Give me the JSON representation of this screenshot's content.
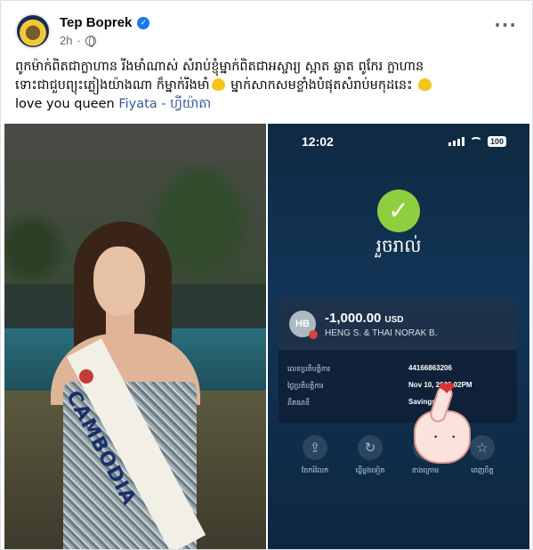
{
  "post": {
    "author": "Tep Boprek",
    "time": "2h",
    "verified_icon": "verified-badge-icon",
    "privacy_icon": "globe-icon",
    "more_label": "···"
  },
  "caption": {
    "line1": "ពូកម៉ាក់ពិតជាក្លាហាន រីងមាំណាស់ សំរាប់ខ្ញុំម្នាក់ពិតជាអស្ចារ្យ ស្អាត ឆ្លាត ពូកែរ ក្លាហាន",
    "line2_a": "ទោះជាជួបព្យុះភ្លៀងយ៉ាងណា ក៏ម្នាក់រីងមាំ",
    "line2_b": " ម្នាក់សាកសមខ្លាំងបំផុតសំរាប់មកុដនេះ ",
    "line3_a": "love you queen ",
    "link": "Fiyata - ហ្វីយ៉ាតា",
    "emoji": "yellow-heart"
  },
  "left_photo": {
    "sash_text": "CAMBODIA"
  },
  "right_photo": {
    "status_time": "12:02",
    "battery": "100",
    "success_text": "រួចរាល់",
    "tx_avatar": "HB",
    "tx_amount": "-1,000.00",
    "tx_currency": "USD",
    "tx_names": "HENG S. & THAI NORAK B.",
    "rows": [
      {
        "label": "លេខប្រតិបត្តិការ",
        "value": "44166863206"
      },
      {
        "label": "ថ្ងៃប្រតិបត្តិការ",
        "value": "Nov 10, 2023  02PM"
      },
      {
        "label": "ពីគណនី",
        "value": "Savings (  "
      }
    ],
    "actions": [
      {
        "label": "ចែករំលែក",
        "icon": "share-icon"
      },
      {
        "label": "ធ្វើម្តងទៀត",
        "icon": "repeat-icon"
      },
      {
        "label": "ខាងក្រោម",
        "icon": "save-icon"
      },
      {
        "label": "ពេញចិត្ត",
        "icon": "star-icon"
      }
    ],
    "sticker": "heart-hand-sticker"
  },
  "colors": {
    "link": "#385898",
    "verified": "#1877f2",
    "check": "#8dcf3f",
    "bank_bg": "#123456"
  }
}
